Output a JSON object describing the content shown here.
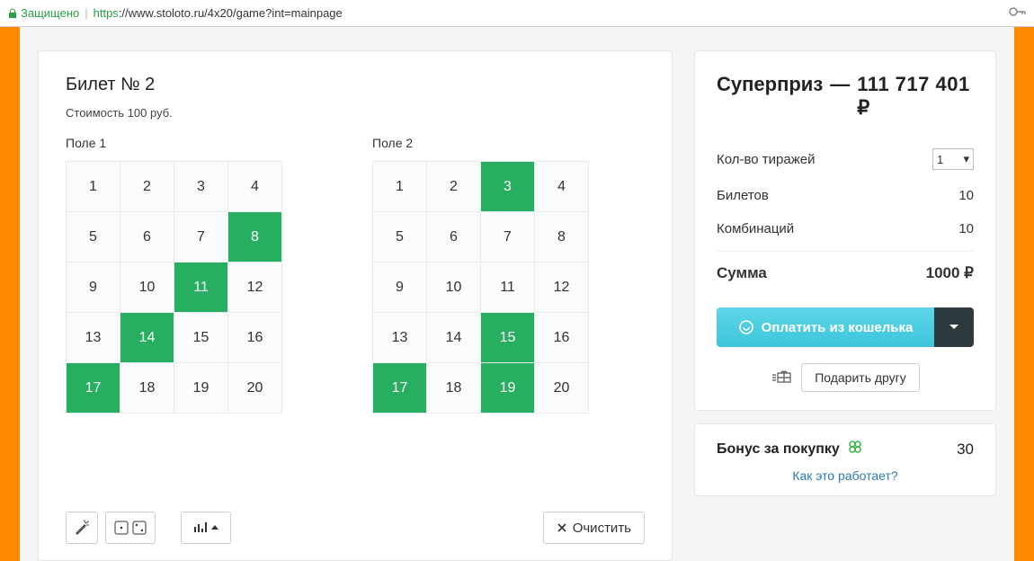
{
  "addr": {
    "secure": "Защищено",
    "proto": "https",
    "url_rest": "://www.stoloto.ru/4x20/game?int=mainpage"
  },
  "ticket": {
    "title": "Билет № 2",
    "cost": "Стоимость 100 руб.",
    "field1_label": "Поле 1",
    "field2_label": "Поле 2",
    "numbers": [
      1,
      2,
      3,
      4,
      5,
      6,
      7,
      8,
      9,
      10,
      11,
      12,
      13,
      14,
      15,
      16,
      17,
      18,
      19,
      20
    ],
    "field1_selected": [
      8,
      11,
      14,
      17
    ],
    "field2_selected": [
      3,
      15,
      17,
      19
    ],
    "clear_label": "Очистить"
  },
  "summary": {
    "prize_label": "Суперприз",
    "prize_value": "111 717 401 ₽",
    "draws_label": "Кол-во тиражей",
    "draws_value": "1",
    "tickets_label": "Билетов",
    "tickets_value": "10",
    "combos_label": "Комбинаций",
    "combos_value": "10",
    "total_label": "Сумма",
    "total_value": "1000 ₽",
    "pay_label": "Оплатить из кошелька",
    "gift_label": "Подарить другу"
  },
  "bonus": {
    "label": "Бонус за покупку",
    "value": "30",
    "how_link": "Как это работает?"
  }
}
